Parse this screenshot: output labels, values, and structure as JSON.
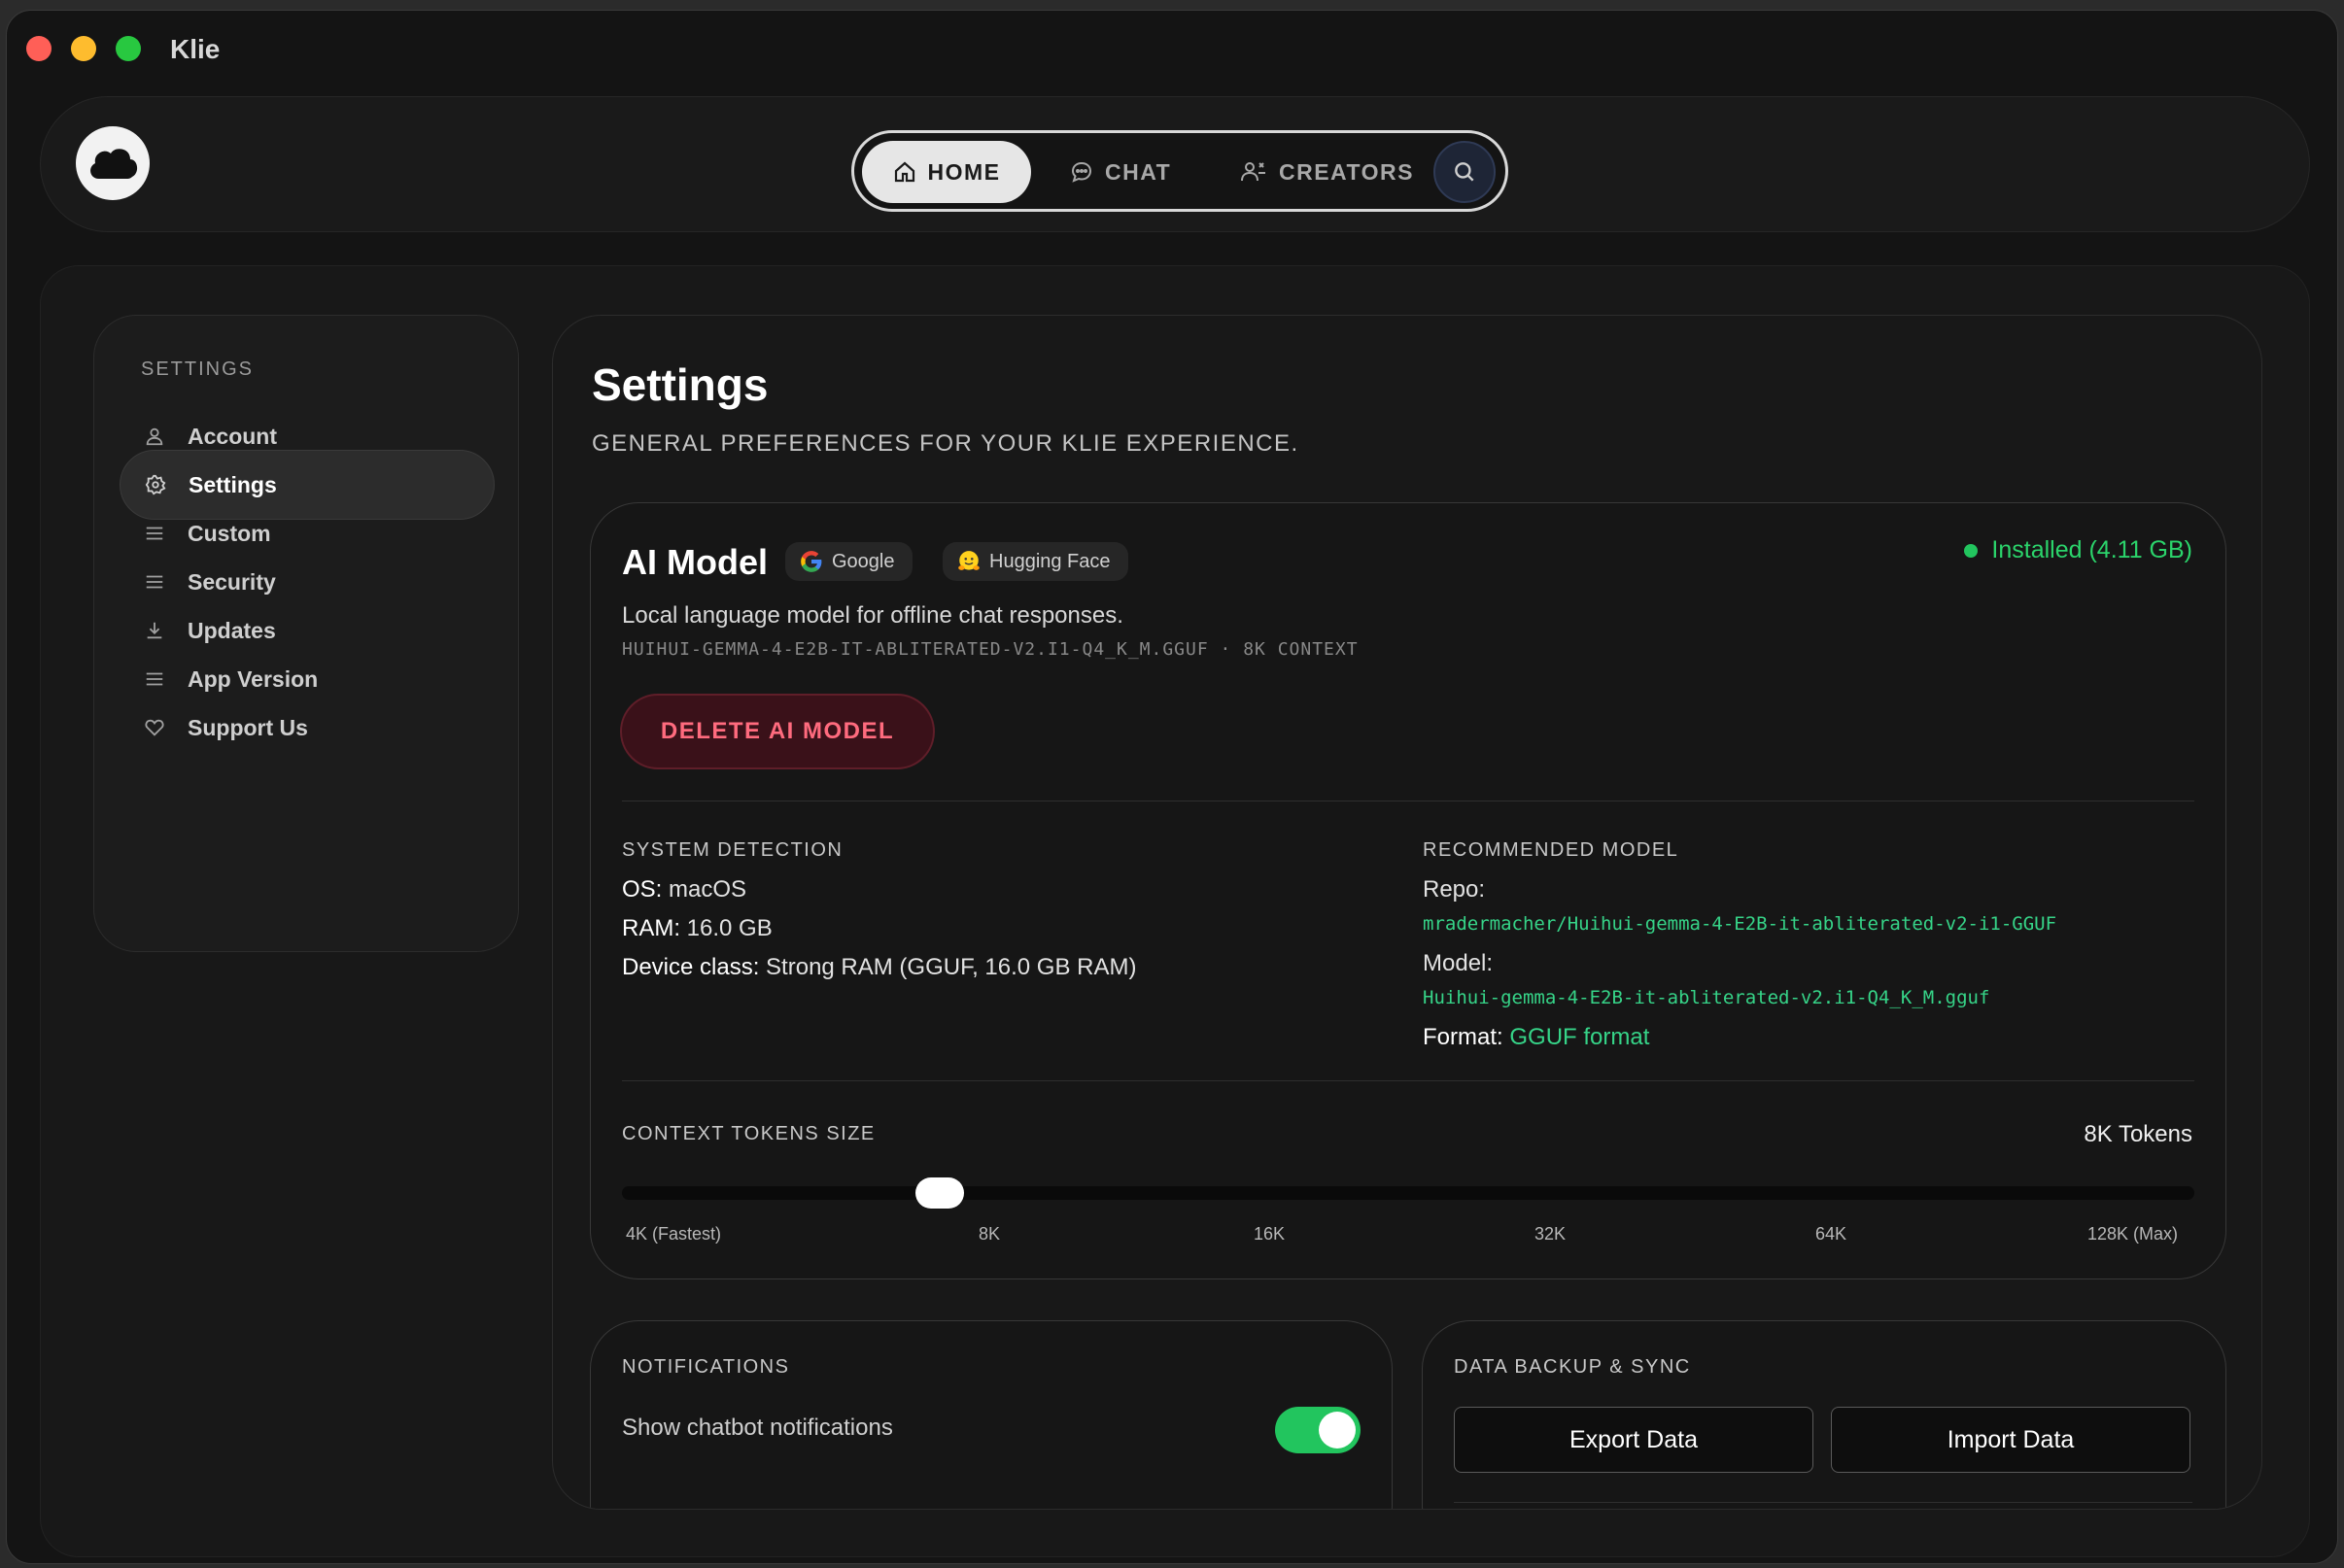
{
  "app": {
    "title": "Klie"
  },
  "nav": {
    "home": "HOME",
    "chat": "CHAT",
    "creators": "CREATORS"
  },
  "sidebar": {
    "heading": "SETTINGS",
    "items": [
      {
        "label": "Account",
        "icon": "user-icon"
      },
      {
        "label": "Settings",
        "icon": "gear-icon",
        "active": true
      },
      {
        "label": "Custom",
        "icon": "menu-icon"
      },
      {
        "label": "Security",
        "icon": "menu-icon"
      },
      {
        "label": "Updates",
        "icon": "download-icon"
      },
      {
        "label": "App Version",
        "icon": "menu-icon"
      },
      {
        "label": "Support Us",
        "icon": "heart-icon"
      }
    ]
  },
  "page": {
    "title": "Settings",
    "subtitle": "GENERAL PREFERENCES FOR YOUR KLIE EXPERIENCE."
  },
  "model": {
    "title": "AI Model",
    "chips": [
      "Google",
      "Hugging Face"
    ],
    "status": "Installed (4.11 GB)",
    "description": "Local language model for offline chat responses.",
    "file_line": "HUIHUI-GEMMA-4-E2B-IT-ABLITERATED-V2.I1-Q4_K_M.GGUF · 8K CONTEXT",
    "delete_label": "DELETE AI MODEL",
    "system": {
      "heading": "SYSTEM DETECTION",
      "os_key": "OS:",
      "os_val": "macOS",
      "ram_key": "RAM:",
      "ram_val": "16.0 GB",
      "device_key": "Device class:",
      "device_val": "Strong RAM (GGUF, 16.0 GB RAM)"
    },
    "recommended": {
      "heading": "RECOMMENDED MODEL",
      "repo_key": "Repo:",
      "repo_val": "mradermacher/Huihui-gemma-4-E2B-it-abliterated-v2-i1-GGUF",
      "model_key": "Model:",
      "model_val": "Huihui-gemma-4-E2B-it-abliterated-v2.i1-Q4_K_M.gguf",
      "format_key": "Format:",
      "format_val": "GGUF format"
    },
    "context": {
      "heading": "CONTEXT TOKENS SIZE",
      "value": "8K Tokens",
      "ticks": [
        "4K (Fastest)",
        "8K",
        "16K",
        "32K",
        "64K",
        "128K (Max)"
      ],
      "selected_index": 1
    }
  },
  "notifications": {
    "heading": "NOTIFICATIONS",
    "label": "Show chatbot notifications",
    "enabled": true
  },
  "backup": {
    "heading": "DATA BACKUP & SYNC",
    "export_label": "Export Data",
    "import_label": "Import Data"
  },
  "colors": {
    "accent_green": "#22c55e",
    "danger": "#ff6b7e",
    "background": "#141414"
  }
}
